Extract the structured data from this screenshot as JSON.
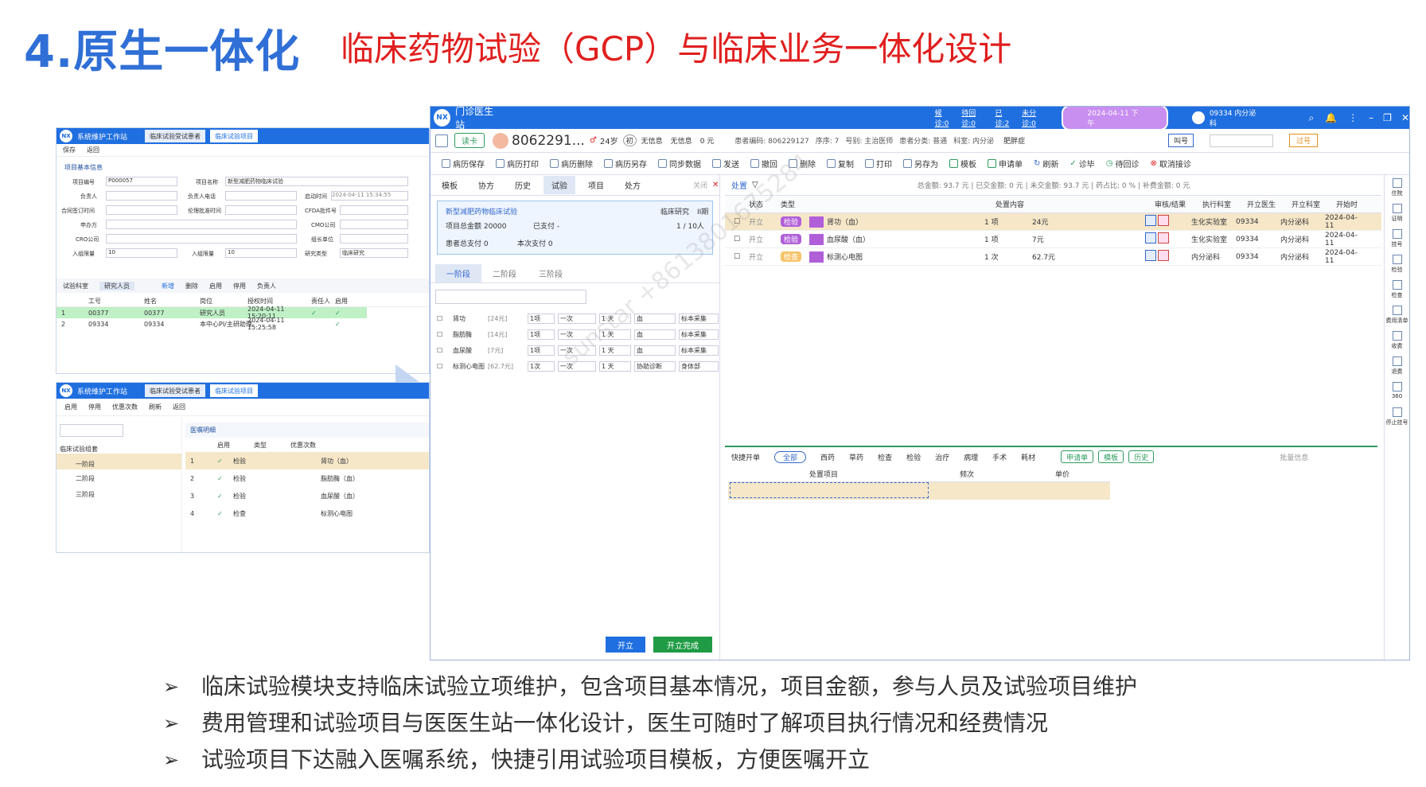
{
  "header": {
    "number_title": "4.原生一体化",
    "subtitle": "临床药物试验（GCP）与临床业务一体化设计"
  },
  "bullets": [
    "临床试验模块支持临床试验立项维护，包含项目基本情况，项目金额，参与人员及试验项目维护",
    "费用管理和试验项目与医医生站一体化设计，医生可随时了解项目执行情况和经费情况",
    "试验项目下达融入医嘱系统，快捷引用试验项目模板，方便医嘱开立"
  ],
  "watermark": "sunstar +8613801675284",
  "win1": {
    "logo": "NX",
    "title": "系统维护工作站",
    "tabs": [
      "临床试验受试患者",
      "临床试验项目"
    ],
    "toolbar": [
      "保存",
      "返回"
    ],
    "section": "项目基本信息",
    "fields": {
      "xmbh": "项目编号",
      "xmbh_v": "P000057",
      "xmmc": "项目名称",
      "xmmc_v": "新型减肥药物临床试验",
      "fzr": "负责人",
      "fzrdh": "负责人电话",
      "qdsj": "启动时间",
      "qdsj_v": "2024-04-11 15:34:55",
      "htqd": "合同签订时间",
      "llpz": "伦理批准时间",
      "cfda": "CFDA批件号",
      "sfdw": "申办方",
      "cmo": "CMO公司",
      "cro": "CRO公司",
      "zzdw": "组长单位",
      "rzxe": "入组限量",
      "rzxe_v": "10",
      "rzyl": "入组限量",
      "rzyl_v": "10",
      "yjlx": "研究类型",
      "yjlx_v": "临床研究"
    },
    "sub_tabs": [
      "试验科室",
      "研究人员"
    ],
    "sub_actions": [
      "新增",
      "删除",
      "启用",
      "停用",
      "负责人"
    ],
    "cols": [
      "工号",
      "姓名",
      "岗位",
      "授权时间",
      "责任人",
      "启用"
    ],
    "rows": [
      {
        "n": "1",
        "id": "00377",
        "name": "00377",
        "role": "研究人员",
        "time": "2024-04-11 15:20:11",
        "r": "✓",
        "e": "✓"
      },
      {
        "n": "2",
        "id": "09334",
        "name": "09334",
        "role": "本中心PI/主研助理",
        "time": "2024-04-11 15:25:58",
        "r": "",
        "e": "✓"
      }
    ]
  },
  "win2": {
    "logo": "NX",
    "title": "系统维护工作站",
    "tabs": [
      "临床试验受试患者",
      "临床试验项目"
    ],
    "toolbar": [
      "启用",
      "停用",
      "优惠次数",
      "刷新",
      "返回"
    ],
    "tree_root": "临床试验组套",
    "tree": [
      "一阶段",
      "二阶段",
      "三阶段"
    ],
    "detail_title": "医嘱明细",
    "cols": [
      "启用",
      "类型",
      "优惠次数"
    ],
    "rows": [
      {
        "n": "1",
        "type": "检验",
        "name": "肾功（血）"
      },
      {
        "n": "2",
        "type": "检验",
        "name": "脂肪酶（血）"
      },
      {
        "n": "3",
        "type": "检验",
        "name": "血尿酸（血）"
      },
      {
        "n": "4",
        "type": "检查",
        "name": "标测心电图"
      }
    ]
  },
  "main": {
    "logo": "NX",
    "title": "门诊医生站",
    "queue": [
      "候诊:0",
      "待回诊:0",
      "已诊:2",
      "未分诊:0"
    ],
    "date": "2024-04-11 下午",
    "user": "09334 内分泌科",
    "patient": {
      "card": "读卡",
      "id": "8062291...",
      "age": "24岁",
      "first": "初",
      "allergy": "无信息",
      "tag": "无信息",
      "cost": "0 元",
      "info": "患者编码: 806229127",
      "seq": "序序: 7",
      "doc": "号别: 主治医师",
      "cat": "患者分类: 普通",
      "dept": "科室: 内分泌",
      "diag": "肥胖症",
      "call": "叫号",
      "pass": "过号"
    },
    "toolbar": [
      "病历保存",
      "病历打印",
      "病历删除",
      "病历另存",
      "同步数据",
      "发送",
      "撤回",
      "删除",
      "复制",
      "打印",
      "另存为",
      "模板",
      "申请单",
      "刷新",
      "诊毕",
      "待回诊",
      "取消接诊"
    ],
    "left_tabs": [
      "模板",
      "协方",
      "历史",
      "试验",
      "项目",
      "处方"
    ],
    "left_close": "关闭",
    "trial": {
      "name": "新型减肥药物临床试验",
      "type": "临床研究",
      "phase": "II期",
      "total": "项目总金额 20000",
      "paid": "已支付 -",
      "count": "1 / 10人",
      "patient_total": "患者总支付 0",
      "current": "本次支付 0"
    },
    "stages": [
      "一阶段",
      "二阶段",
      "三阶段"
    ],
    "items": [
      {
        "name": "肾功",
        "price": "[24元]",
        "qty": "1项",
        "freq": "一次",
        "days": "1 天",
        "spec": "血",
        "sample": "标本采集"
      },
      {
        "name": "脂肪酶",
        "price": "[14元]",
        "qty": "1项",
        "freq": "一次",
        "days": "1 天",
        "spec": "血",
        "sample": "标本采集"
      },
      {
        "name": "血尿酸",
        "price": "[7元]",
        "qty": "1项",
        "freq": "一次",
        "days": "1 天",
        "spec": "血",
        "sample": "标本采集"
      },
      {
        "name": "标测心电图",
        "price": "[62.7元]",
        "qty": "1次",
        "freq": "一次",
        "days": "1 天",
        "spec": "协助诊断",
        "sample": "身体部"
      }
    ],
    "btn_open": "开立",
    "btn_done": "开立完成",
    "right_title": "处置",
    "summary": "总金额: 93.7 元  |  已交金额: 0 元  |  未交金额: 93.7 元  |  药占比: 0 %  |  补费金额: 0 元",
    "cols": [
      "状态",
      "类型",
      "处置内容",
      "审核/结果",
      "执行科室",
      "开立医生",
      "开立科室",
      "开始时"
    ],
    "orders": [
      {
        "st": "开立",
        "type": "检验",
        "name": "肾功（血）",
        "qty": "1 项",
        "price": "24元",
        "dept": "生化实验室",
        "doc": "09334",
        "odept": "内分泌科",
        "date": "2024-04-11"
      },
      {
        "st": "开立",
        "type": "检验",
        "name": "血尿酸（血）",
        "qty": "1 项",
        "price": "7元",
        "dept": "生化实验室",
        "doc": "09334",
        "odept": "内分泌科",
        "date": "2024-04-11"
      },
      {
        "st": "开立",
        "type": "检查",
        "name": "标测心电图",
        "qty": "1 次",
        "price": "62.7元",
        "dept": "内分泌科",
        "doc": "09334",
        "odept": "内分泌科",
        "date": "2024-04-11"
      }
    ],
    "quick_tabs": [
      "快捷开单",
      "全部",
      "西药",
      "草药",
      "检查",
      "检验",
      "治疗",
      "病理",
      "手术",
      "耗材"
    ],
    "quick_chips": [
      "申请单",
      "模板",
      "历史"
    ],
    "batch": "批量信息",
    "quick_cols": [
      "处置项目",
      "频次",
      "单价"
    ],
    "side": [
      "住院",
      "证明",
      "挂号",
      "检验",
      "检查",
      "费用清单",
      "收费",
      "退费",
      "360",
      "停止挂号"
    ]
  }
}
